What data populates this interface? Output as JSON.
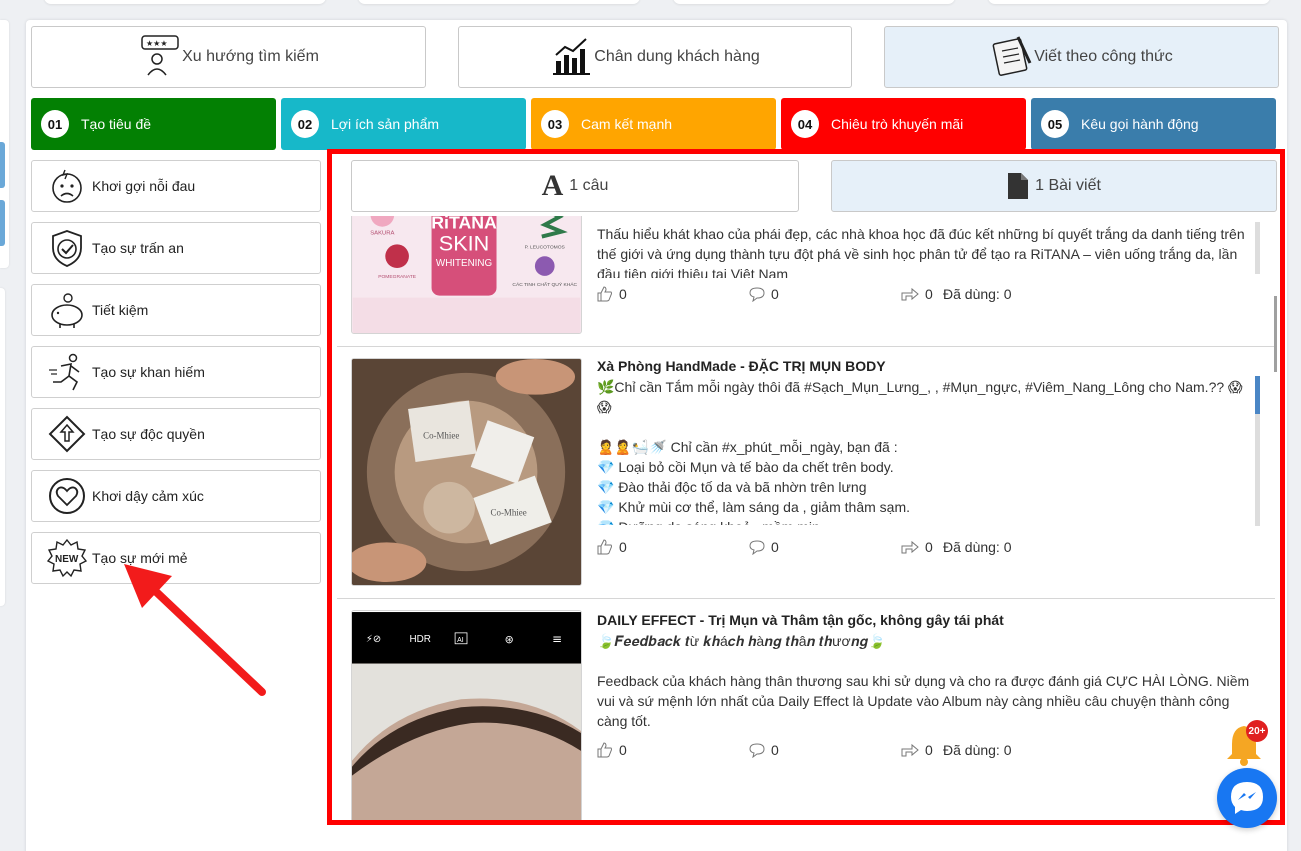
{
  "top_buttons": [
    {
      "label": "Xu hướng tìm kiếm",
      "icon": "search-trend-icon"
    },
    {
      "label": "Chân dung khách hàng",
      "icon": "bar-chart-icon"
    },
    {
      "label": "Viết theo công thức",
      "icon": "notepad-pencil-icon"
    }
  ],
  "steps": [
    {
      "num": "01",
      "label": "Tạo tiêu đề",
      "color": "#038003"
    },
    {
      "num": "02",
      "label": "Lợi ích sản phẩm",
      "color": "#17b8c9"
    },
    {
      "num": "03",
      "label": "Cam kết mạnh",
      "color": "#ffa500"
    },
    {
      "num": "04",
      "label": "Chiêu trò khuyến mãi",
      "color": "#ff0000"
    },
    {
      "num": "05",
      "label": "Kêu gọi hành động",
      "color": "#3a7dab"
    }
  ],
  "left_items": [
    {
      "label": "Khơi gợi nỗi đau",
      "icon": "pain-face-icon"
    },
    {
      "label": "Tạo sự trấn an",
      "icon": "shield-check-icon"
    },
    {
      "label": "Tiết kiệm",
      "icon": "piggy-bank-icon"
    },
    {
      "label": "Tạo sự khan hiếm",
      "icon": "running-person-icon"
    },
    {
      "label": "Tạo sự độc quyền",
      "icon": "diamond-arrow-icon"
    },
    {
      "label": "Khơi dậy cảm xúc",
      "icon": "heart-icon"
    },
    {
      "label": "Tạo sự mới mẻ",
      "icon": "new-badge-icon"
    }
  ],
  "tabs": [
    {
      "label": "1 câu",
      "icon": "letter-a-icon"
    },
    {
      "label": "1 Bài viết",
      "icon": "document-icon"
    }
  ],
  "posts": [
    {
      "title": "",
      "thumb_text": {
        "brand": "RiTANA",
        "line1": "SKIN",
        "line2": "WHITENING",
        "tag1": "SAKURA",
        "tag2": "P. LEUCOTOMOS",
        "tag3": "POMEGRANATE",
        "tag4": "CÁC TINH CHẤT QUÝ KHÁC"
      },
      "body": "Thấu hiểu khát khao của phái đẹp, các nhà khoa học đã đúc kết những bí quyết trắng da danh tiếng trên thế giới và ứng dụng thành tựu đột phá về sinh học phân tử để tạo ra RiTANA – viên uống trắng da, lần đầu tiên giới thiệu tại Việt Nam",
      "likes": "0",
      "comments": "0",
      "shares": "0",
      "used_label": "Đã dùng: 0"
    },
    {
      "title": "Xà Phòng HandMade - ĐẶC TRỊ MỤN BODY",
      "thumb_text": {
        "soap1": "Co-Mhiee",
        "soap2": "Co-Mhiee"
      },
      "body_lines": [
        "🌿Chỉ cần Tắm mỗi ngày thôi đã #Sạch_Mụn_Lưng_, , #Mụn_ngực, #Viêm_Nang_Lông cho Nam.?? 😱",
        "😱",
        "",
        "🙎🙎🛀🚿 Chỉ cần #x_phút_mỗi_ngày, bạn đã :",
        "💎 Loại bỏ cồi Mụn và tế bào da chết trên body.",
        "💎 Đào thải độc tố da và bã nhờn trên lưng",
        "💎 Khử mùi cơ thể, làm sáng da , giảm thâm sạm.",
        "💎 Dưỡng da sáng khoẻ , mềm mịn"
      ],
      "likes": "0",
      "comments": "0",
      "shares": "0",
      "used_label": "Đã dùng: 0"
    },
    {
      "title": "DAILY EFFECT - Trị Mụn và Thâm tận gốc, không gây tái phát",
      "subtitle": "🍃𝑭𝒆𝒆𝒅𝒃𝒂𝒄𝒌 𝒕ừ 𝒌𝒉á𝒄𝒉 𝒉à𝒏𝒈 𝒕𝒉â𝒏 𝒕𝒉ươ𝒏𝒈🍃",
      "thumb_text": {
        "cam1": "⚡⊘",
        "cam2": "HDR",
        "cam3": "AI",
        "cam4": "⊛",
        "cam5": "≡"
      },
      "body": "Feedback của khách hàng thân thương sau khi sử dụng và cho ra được đánh giá CỰC HÀI LÒNG. Niềm vui và sứ mệnh lớn nhất của Daily Effect là Update vào Album này càng nhiều câu chuyện thành công càng tốt.",
      "likes": "0",
      "comments": "0",
      "shares": "0",
      "used_label": "Đã dùng: 0"
    }
  ],
  "notification_badge": "20+",
  "colors": {
    "highlight_red": "#ff0000",
    "active_tab_bg": "#e6f0f9",
    "messenger_blue": "#1877f2"
  }
}
